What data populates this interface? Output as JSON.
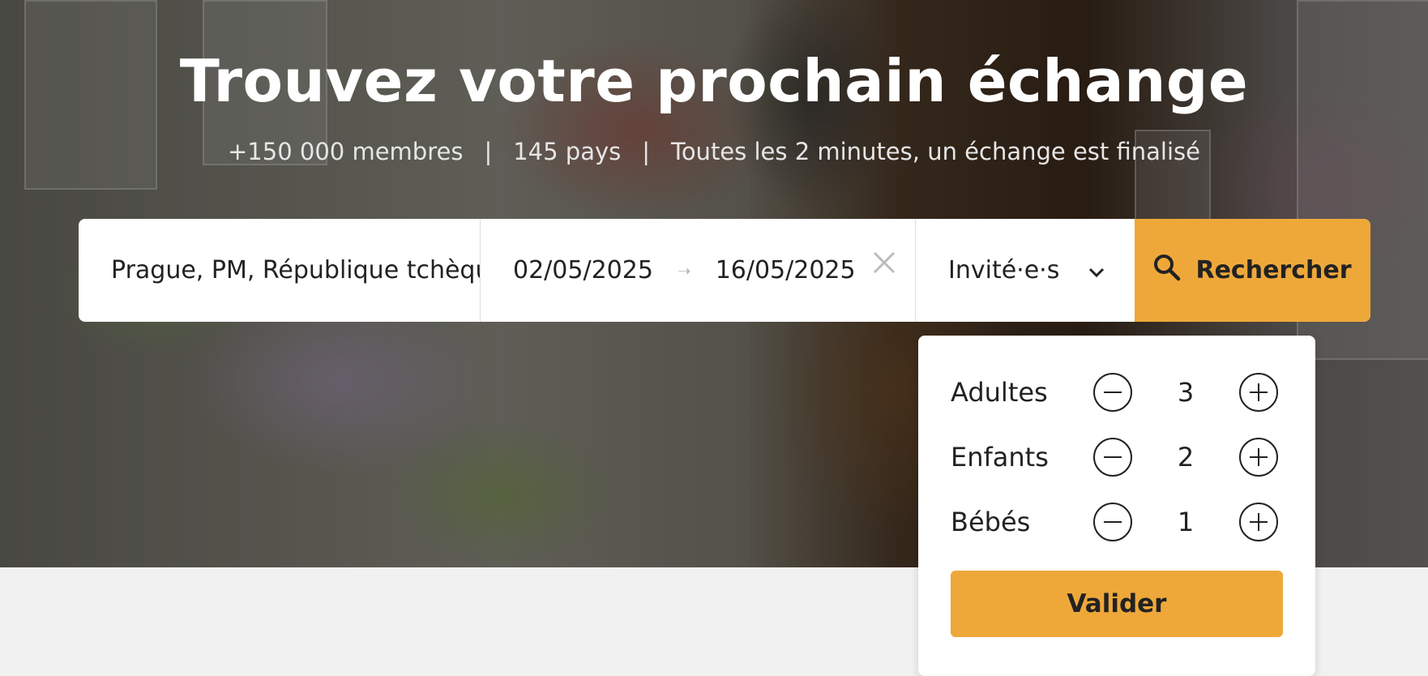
{
  "hero": {
    "title": "Trouvez votre prochain échange",
    "stats": [
      "+150 000 membres",
      "145 pays",
      "Toutes les 2 minutes, un échange est finalisé"
    ],
    "separator": "|"
  },
  "search": {
    "destination": "Prague, PM, République tchèque",
    "date_start": "02/05/2025",
    "date_end": "16/05/2025",
    "guests_label": "Invité·e·s",
    "button_label": "Rechercher"
  },
  "guests_dropdown": {
    "rows": [
      {
        "label": "Adultes",
        "value": "3"
      },
      {
        "label": "Enfants",
        "value": "2"
      },
      {
        "label": "Bébés",
        "value": "1"
      }
    ],
    "submit_label": "Valider"
  },
  "colors": {
    "accent": "#eea83a",
    "text": "#222222",
    "page_bg": "#f1f1f1"
  },
  "icons": {
    "clear": "close-icon",
    "dropdown": "chevron-down-icon",
    "search": "search-icon",
    "decrement": "minus-circle-icon",
    "increment": "plus-circle-icon"
  }
}
